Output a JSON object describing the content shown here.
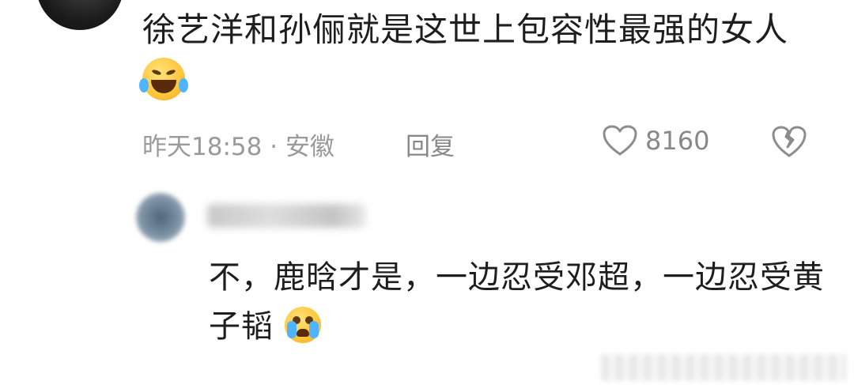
{
  "comment": {
    "text": "徐艺洋和孙俪就是这世上包容性最强的女人",
    "emoji": "rolling-on-floor-laughing-emoji",
    "time_location": "昨天18:58 · 安徽",
    "reply_label": "回复",
    "like_count": "8160"
  },
  "reply": {
    "text": "不，鹿晗才是，一边忍受邓超，一边忍受黄子韬",
    "emoji": "loudly-crying-emoji"
  },
  "colors": {
    "meta_gray": "#9a9a9a",
    "text_dark": "#1e1e1e"
  }
}
